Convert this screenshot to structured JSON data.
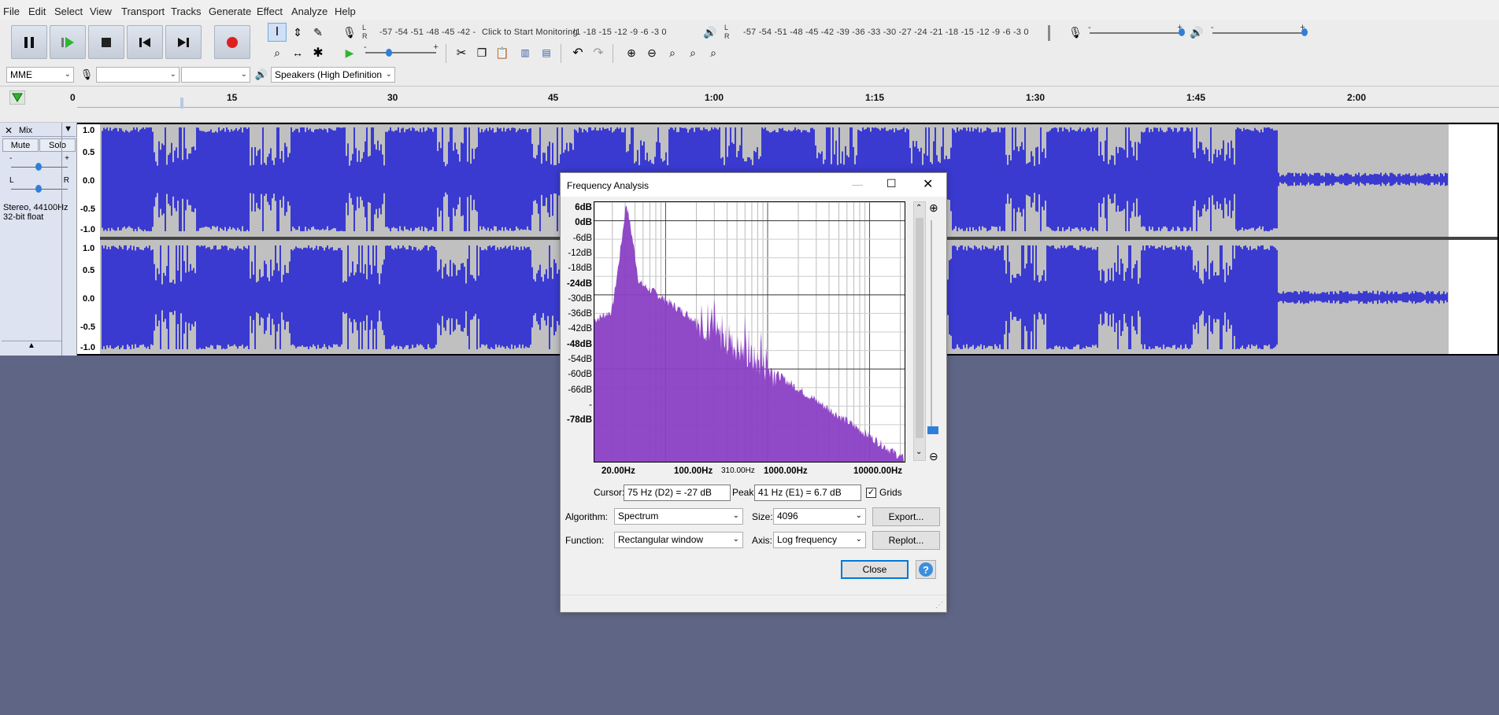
{
  "menu": [
    "File",
    "Edit",
    "Select",
    "View",
    "Transport",
    "Tracks",
    "Generate",
    "Effect",
    "Analyze",
    "Help"
  ],
  "toolbar": {
    "record_meter_scale": "-57 -54 -51 -48 -45 -42 -",
    "monitor_prompt": "Click to Start Monitoring",
    "record_meter_scale_tail": "!1 -18 -15 -12 -9 -6 -3 0",
    "play_meter_scale": "-57 -54 -51 -48 -45 -42 -39 -36 -33 -30 -27 -24 -21 -18 -15 -12 -9 -6 -3 0",
    "meter_l": "L",
    "meter_r": "R",
    "slider_minus": "-",
    "slider_plus": "+"
  },
  "device": {
    "host": "MME",
    "record_device": "",
    "channels": "",
    "playback_device": "Speakers (High Definition"
  },
  "timeline": [
    "0",
    "15",
    "30",
    "45",
    "1:00",
    "1:15",
    "1:30",
    "1:45",
    "2:00"
  ],
  "track": {
    "name": "Mix",
    "mute": "Mute",
    "solo": "Solo",
    "info_line1": "Stereo, 44100Hz",
    "info_line2": "32-bit float",
    "pan_l": "L",
    "pan_r": "R",
    "gain_minus": "-",
    "gain_plus": "+",
    "scale": [
      "1.0",
      "0.5",
      "0.0",
      "-0.5",
      "-1.0"
    ],
    "waveform_color": "#3a3ad0",
    "selection_color": "#5b5be0"
  },
  "dialog": {
    "title": "Frequency Analysis",
    "db_labels": [
      "6dB",
      "0dB",
      "-6dB",
      "-12dB",
      "-18dB",
      "-24dB",
      "-30dB",
      "-36dB",
      "-42dB",
      "-48dB",
      "-54dB",
      "-60dB",
      "-66dB",
      "-",
      "-78dB"
    ],
    "hz_labels": [
      "20.00Hz",
      "100.00Hz",
      "310.00Hz",
      "1000.00Hz",
      "10000.00Hz"
    ],
    "cursor_label": "Cursor:",
    "cursor_value": "75 Hz (D2) = -27 dB",
    "peak_label": "Peak:",
    "peak_value": "41 Hz (E1) = 6.7 dB",
    "grids_label": "Grids",
    "algorithm_label": "Algorithm:",
    "algorithm_value": "Spectrum",
    "size_label": "Size:",
    "size_value": "4096",
    "function_label": "Function:",
    "function_value": "Rectangular window",
    "axis_label": "Axis:",
    "axis_value": "Log frequency",
    "export_label": "Export...",
    "replot_label": "Replot...",
    "close_label": "Close",
    "help_label": "?",
    "spectrum_color": "#8a3fc4"
  }
}
